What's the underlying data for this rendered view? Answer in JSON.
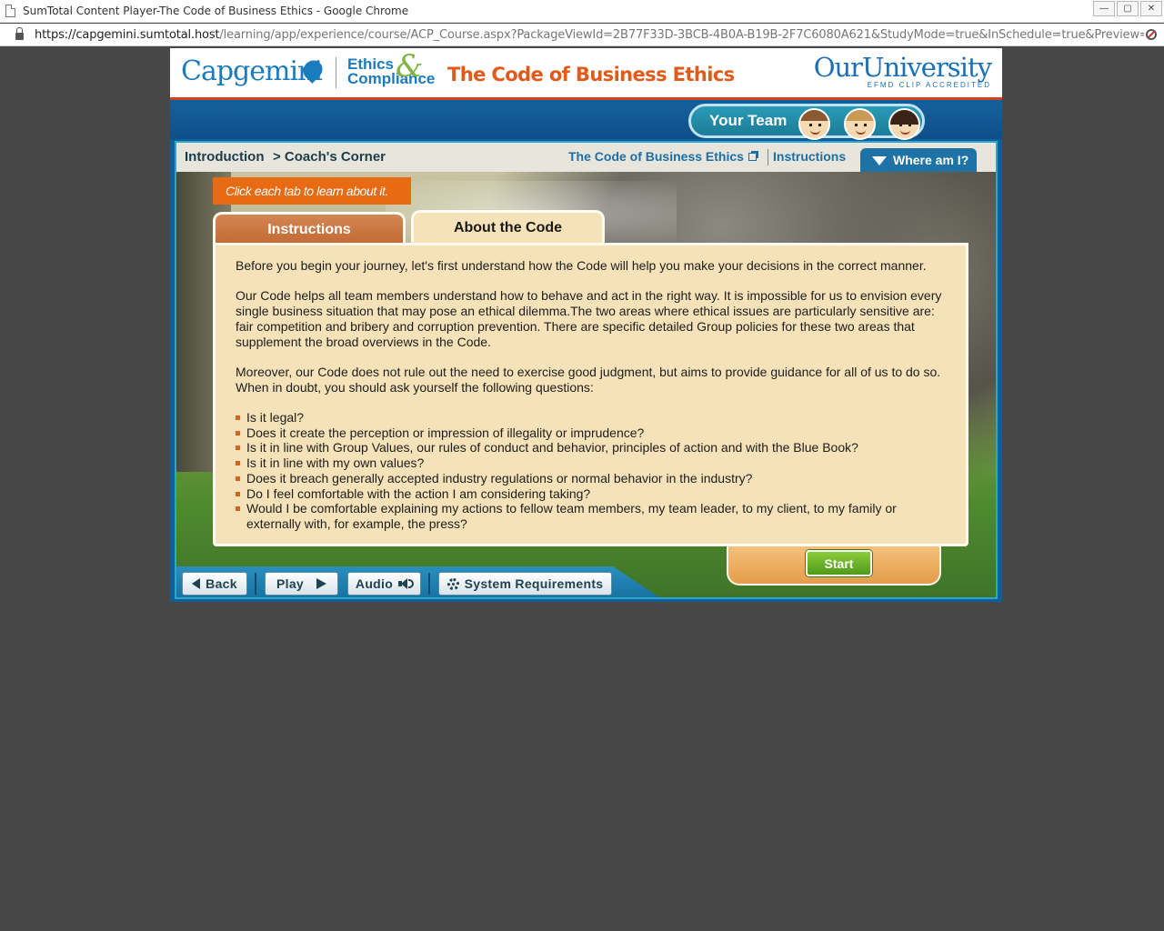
{
  "window": {
    "title": "SumTotal Content Player-The Code of Business Ethics - Google Chrome",
    "controls": [
      "—",
      "▢",
      "✕"
    ]
  },
  "address": {
    "host": "https://capgemini.sumtotal.host",
    "path": "/learning/app/experience/course/ACP_Course.aspx?PackageViewId=2B77F33D-3BCB-4B0A-B19B-2F7C6080A621&StudyMode=true&InSchedule=true&Preview=..."
  },
  "header": {
    "brand": "Capgemini",
    "ethics_line1": "Ethics",
    "ethics_line2": "Compliance",
    "ethics_amp": "&",
    "course_title": "The Code of Business Ethics",
    "university_main": "OurUniversity",
    "university_sub": "EFMD CLIP ACCREDITED"
  },
  "team": {
    "label": "Your Team"
  },
  "breadcrumb": {
    "section": "Introduction",
    "page": "> Coach's Corner"
  },
  "topnav": {
    "code_link": "The Code of Business Ethics",
    "instructions_link": "Instructions",
    "where_am_i": "Where am I?"
  },
  "hint": "Click each tab to learn about it.",
  "tabs": [
    {
      "label": "Instructions",
      "active": false
    },
    {
      "label": "About the Code",
      "active": true
    }
  ],
  "content": {
    "p1": "Before you begin your journey, let's first understand how the Code will help you make your decisions in the correct manner.",
    "p2": "Our Code helps all team members understand how to behave and act in the right way. It is impossible for us to envision every single business situation that may pose an ethical dilemma.The two areas where ethical issues are particularly sensitive are: fair competition and bribery and corruption prevention. There are specific detailed Group policies for these two areas that supplement the broad overviews in the Code.",
    "p3": "Moreover, our Code does not rule out the need to exercise good judgment, but aims to provide guidance for all of us to do so. When in doubt, you should ask yourself the following questions:",
    "questions": [
      "Is it legal?",
      "Does it create the perception or impression of illegality or imprudence?",
      "Is it in line with Group Values, our rules of conduct and behavior, principles of action and with the Blue Book?",
      "Is it in line with my own values?",
      "Does it breach generally accepted industry regulations or normal behavior in the industry?",
      "Do I feel comfortable with the action I am considering taking?",
      "Would I be comfortable explaining my actions to fellow team members, my team leader, to my client, to my family or externally with, for example, the press?"
    ]
  },
  "start_label": "Start",
  "toolbar": {
    "back": "Back",
    "play": "Play",
    "audio": "Audio",
    "sysreq": "System Requirements"
  }
}
